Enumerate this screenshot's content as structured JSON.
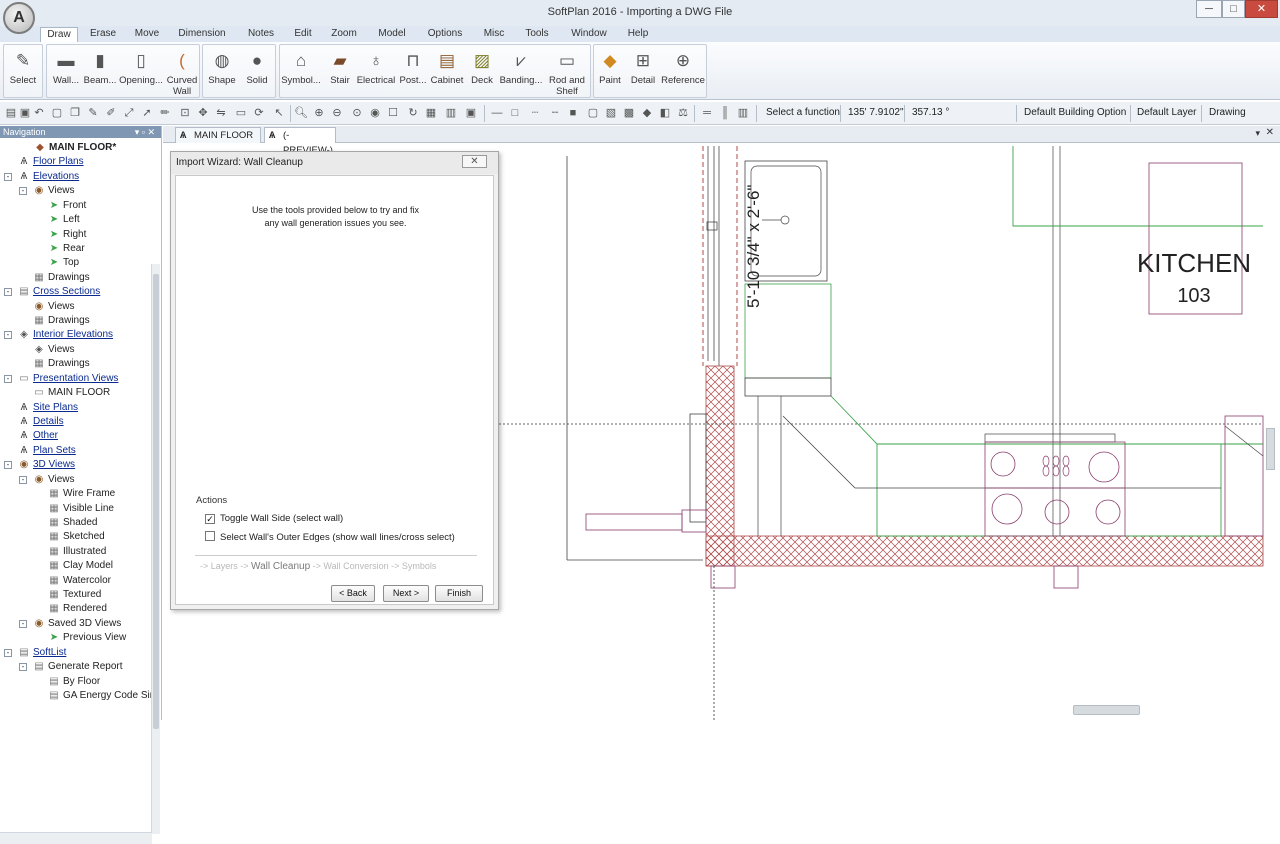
{
  "app": {
    "title": "SoftPlan 2016 - Importing a DWG File"
  },
  "window_controls": {
    "minimize": "─",
    "maximize": "□",
    "close": "✕"
  },
  "menu": [
    "Draw",
    "Erase",
    "Move",
    "Dimension",
    "Notes",
    "Edit",
    "Zoom",
    "Model",
    "Options",
    "Misc",
    "Tools",
    "Window",
    "Help"
  ],
  "ribbon": {
    "select": "Select",
    "wall": "Wall...",
    "beam": "Beam...",
    "opening": "Opening...",
    "curved": "Curved",
    "curved2": "Wall",
    "shape": "Shape",
    "solid": "Solid",
    "symbol": "Symbol...",
    "stair": "Stair",
    "electrical": "Electrical",
    "post": "Post...",
    "cabinet": "Cabinet",
    "deck": "Deck",
    "banding": "Banding...",
    "rod": "Rod and",
    "rod2": "Shelf",
    "paint": "Paint",
    "detail": "Detail",
    "reference": "Reference"
  },
  "status": {
    "function": "Select a function",
    "coord_x": "135' 7.9102\"",
    "angle": "357.13 °",
    "building_option": "Default Building Option",
    "layer": "Default Layer",
    "mode": "Drawing"
  },
  "nav": {
    "header": "Navigation",
    "items": [
      {
        "label": "MAIN FLOOR*",
        "bold": true
      },
      {
        "label": "Floor Plans",
        "link": true
      },
      {
        "label": "Elevations",
        "link": true
      },
      {
        "label": "Views"
      },
      {
        "label": "Front"
      },
      {
        "label": "Left"
      },
      {
        "label": "Right"
      },
      {
        "label": "Rear"
      },
      {
        "label": "Top"
      },
      {
        "label": "Drawings"
      },
      {
        "label": "Cross Sections",
        "link": true
      },
      {
        "label": "Views"
      },
      {
        "label": "Drawings"
      },
      {
        "label": "Interior Elevations",
        "link": true
      },
      {
        "label": "Views"
      },
      {
        "label": "Drawings"
      },
      {
        "label": "Presentation Views",
        "link": true
      },
      {
        "label": "MAIN FLOOR"
      },
      {
        "label": "Site Plans",
        "link": true
      },
      {
        "label": "Details",
        "link": true
      },
      {
        "label": "Other",
        "link": true
      },
      {
        "label": "Plan Sets",
        "link": true
      },
      {
        "label": "3D Views",
        "link": true
      },
      {
        "label": "Views"
      },
      {
        "label": "Wire Frame"
      },
      {
        "label": "Visible Line"
      },
      {
        "label": "Shaded"
      },
      {
        "label": "Sketched"
      },
      {
        "label": "Illustrated"
      },
      {
        "label": "Clay Model"
      },
      {
        "label": "Watercolor"
      },
      {
        "label": "Textured"
      },
      {
        "label": "Rendered"
      },
      {
        "label": "Saved 3D Views"
      },
      {
        "label": "Previous View"
      },
      {
        "label": "SoftList",
        "link": true
      },
      {
        "label": "Generate Report"
      },
      {
        "label": "By Floor"
      },
      {
        "label": "GA Energy Code Sir"
      }
    ]
  },
  "doc_tabs": [
    "MAIN FLOOR",
    "(-PREVIEW-)"
  ],
  "wizard": {
    "title": "Import Wizard: Wall Cleanup",
    "close": "✕",
    "message_line1": "Use the tools provided below to try and fix",
    "message_line2": "any wall generation issues you see.",
    "actions_label": "Actions",
    "toggle_label": "Toggle Wall Side (select wall)",
    "toggle_checked": true,
    "outer_label": "Select Wall's Outer Edges (show wall lines/cross select)",
    "outer_checked": false,
    "step_prev": "-> Layers ->",
    "step_current": "Wall Cleanup",
    "step_next": "-> Wall Conversion -> Symbols",
    "back": "< Back",
    "next": "Next >",
    "finish": "Finish"
  },
  "drawing": {
    "room_name": "KITCHEN",
    "room_number": "103",
    "door_label": "5'-10 3/4\" x 2'-6\""
  },
  "colors": {
    "wall_line": "#8a3d6b",
    "green": "#3aa34a",
    "hatch": "#b04a4a",
    "blue_line": "#4b5563"
  }
}
